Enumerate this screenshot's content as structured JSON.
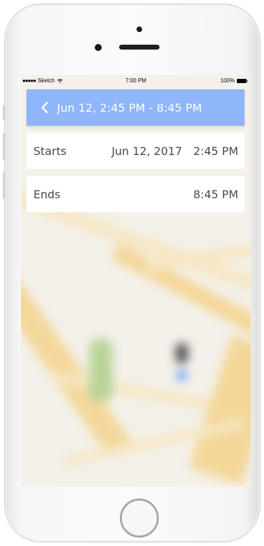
{
  "status_bar": {
    "carrier": "Sketch",
    "signal_dots": "●●●●●",
    "time": "7:00 PM",
    "battery": "100%"
  },
  "header": {
    "title": "Jun 12, 2:45 PM - 8:45 PM",
    "back_icon": "chevron-left-icon",
    "color": "#8fb5fa"
  },
  "rows": {
    "starts": {
      "label": "Starts",
      "date": "Jun 12, 2017",
      "time": "2:45 PM"
    },
    "ends": {
      "label": "Ends",
      "time": "8:45 PM"
    }
  },
  "colors": {
    "header_bg": "#8fb5fa",
    "row_text": "#4a4a4a",
    "location_dot": "#4a8ef5"
  }
}
